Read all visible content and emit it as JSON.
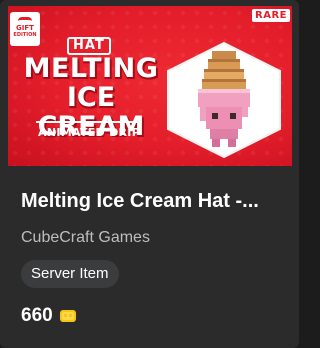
{
  "item": {
    "thumbnail": {
      "gift_badge_line1": "GIFT",
      "gift_badge_line2": "EDITION",
      "rare_badge": "RARE",
      "hat_tag": "HAT",
      "title_line1": "MELTING",
      "title_line2": "ICE CREAM",
      "subtitle": "ANIMATED DRIP"
    },
    "name": "Melting Ice Cream Hat -...",
    "creator": "CubeCraft Games",
    "tag": "Server Item",
    "price": "660"
  },
  "icons": {
    "gift": "gift-icon",
    "currency": "minecoin-icon"
  },
  "colors": {
    "card_bg": "#2b2b2b",
    "thumb_red": "#e31d2a",
    "pill_bg": "#3b3c3d",
    "creator_text": "#bdbebe",
    "coin_gold": "#f5c518"
  }
}
